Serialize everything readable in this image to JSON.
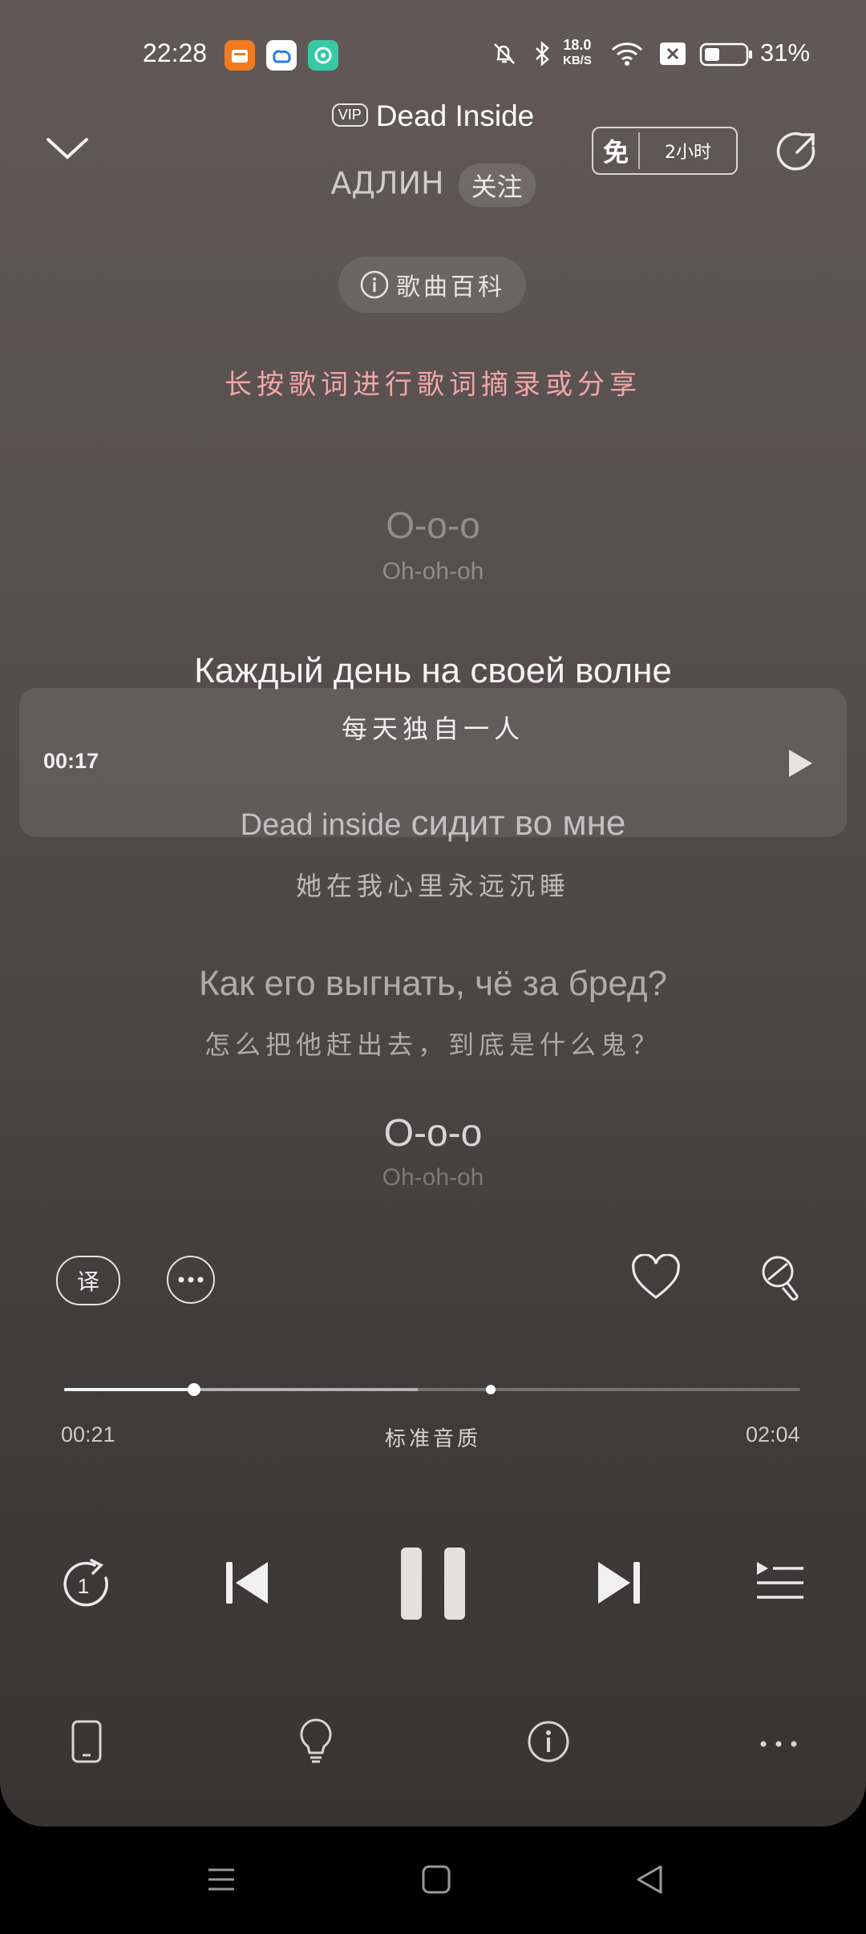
{
  "status_bar": {
    "time": "22:28",
    "net_speed_value": "18.0",
    "net_speed_unit": "KB/S",
    "battery": "31%"
  },
  "header": {
    "vip_label": "VIP",
    "song_title": "Dead Inside",
    "artist": "АДЛИН",
    "follow_label": "关注",
    "free_badge_char": "免",
    "free_badge_duration": "2小时"
  },
  "wiki_button_label": "歌曲百科",
  "hint_text": "长按歌词进行歌词摘录或分享",
  "lyrics": [
    {
      "main": "О-о-о",
      "sub": "Oh-oh-oh"
    },
    {
      "main": "Каждый день на своей волне",
      "sub": "每天独自一人"
    },
    {
      "main_a": "Dead inside",
      "main_b": " сидит во мне",
      "sub": "她在我心里永远沉睡"
    },
    {
      "main": "Как его выгнать, чё за бред?",
      "sub": "怎么把他赶出去，到底是什么鬼？"
    },
    {
      "main": "О-о-о",
      "sub": "Oh-oh-oh"
    }
  ],
  "seek_preview_time": "00:17",
  "action_row": {
    "translate_label": "译"
  },
  "progress": {
    "current": "00:21",
    "total": "02:04",
    "quality_label": "标准音质",
    "played_fraction": 0.177,
    "buffered_fraction": 0.48,
    "marker_fraction": 0.58
  },
  "repeat_badge": "1",
  "colors": {
    "hint": "#f1a6a6",
    "background_top": "#625858",
    "background_bottom": "#393434"
  }
}
